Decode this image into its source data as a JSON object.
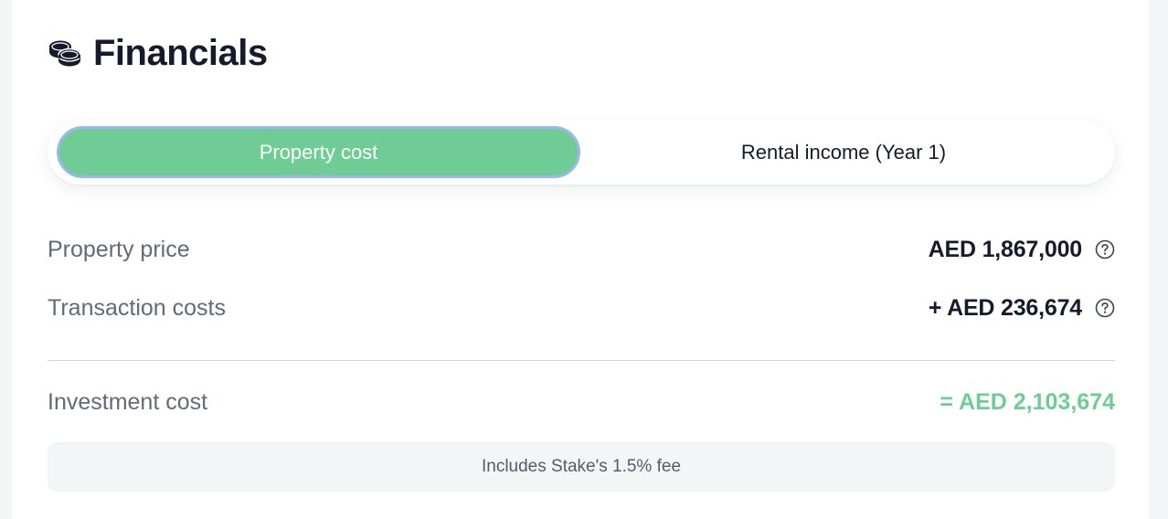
{
  "header": {
    "title": "Financials",
    "icon": "coins-icon"
  },
  "tabs": [
    {
      "label": "Property cost",
      "active": true
    },
    {
      "label": "Rental income (Year 1)",
      "active": false
    }
  ],
  "rows": [
    {
      "label": "Property price",
      "value": "AED 1,867,000",
      "icon": "help-icon"
    },
    {
      "label": "Transaction costs",
      "value": "+ AED 236,674",
      "icon": "help-icon"
    }
  ],
  "total": {
    "label": "Investment cost",
    "value": "= AED 2,103,674"
  },
  "note": "Includes Stake's 1.5% fee",
  "colors": {
    "accent": "#6fcc94",
    "focus_ring": "#9bb8ee",
    "text_dark": "#151b2c",
    "text_muted": "#636977"
  }
}
